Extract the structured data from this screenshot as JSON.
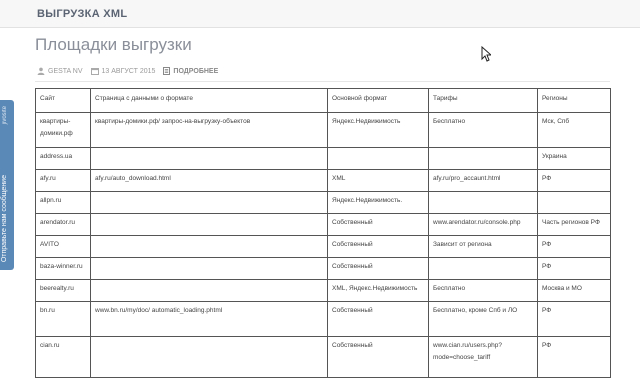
{
  "site_title": "ВЫГРУЗКА XML",
  "page_title": "Площадки выгрузки",
  "meta": {
    "author": "GESTA NV",
    "date": "13 АВГУСТ 2015",
    "readmore": "ПОДРОБНЕЕ"
  },
  "feedback": {
    "label": "Отправьте нам сообщение",
    "brand": "jivosite"
  },
  "table": {
    "headers": [
      "Сайт",
      "Страница с данными о формате",
      "Основной формат",
      "Тарифы",
      "Регионы"
    ],
    "rows": [
      {
        "site": "квартиры-домики.рф",
        "page": "квартиры-домики.рф/ запрос-на-выгрузку-объектов",
        "format": "Яндекс.Недвижимость",
        "tariff": "Бесплатно",
        "region": "Мск, Спб"
      },
      {
        "site": "address.ua",
        "page": "",
        "format": "",
        "tariff": "",
        "region": "Украина"
      },
      {
        "site": "afy.ru",
        "page": "afy.ru/auto_download.html",
        "format": "XML",
        "tariff": "afy.ru/pro_accaunt.html",
        "region": "РФ"
      },
      {
        "site": "allpn.ru",
        "page": "",
        "format": "Яндекс.Недвижимость.",
        "tariff": "",
        "region": ""
      },
      {
        "site": "arendator.ru",
        "page": "",
        "format": "Собственный",
        "tariff": "www.arendator.ru/console.php",
        "region": "Часть регионов РФ"
      },
      {
        "site": "AVITO",
        "page": "",
        "format": "Собственный",
        "tariff": "Зависит от региона",
        "region": "РФ"
      },
      {
        "site": "baza-winner.ru",
        "page": "",
        "format": "Собственный",
        "tariff": "",
        "region": "РФ"
      },
      {
        "site": "beerealty.ru",
        "page": "",
        "format": "XML, Яндекс.Недвижимость",
        "tariff": "Бесплатно",
        "region": "Москва и МО"
      },
      {
        "site": "bn.ru",
        "page": "www.bn.ru/my/doc/ automatic_loading.phtml",
        "format": "Собственный",
        "tariff": "Бесплатно, кроме Спб и ЛО",
        "region": "РФ"
      },
      {
        "site": "cian.ru",
        "page": "",
        "format": "Собственный",
        "tariff": "www.cian.ru/users.php? mode=choose_tariff",
        "region": "РФ"
      }
    ]
  }
}
